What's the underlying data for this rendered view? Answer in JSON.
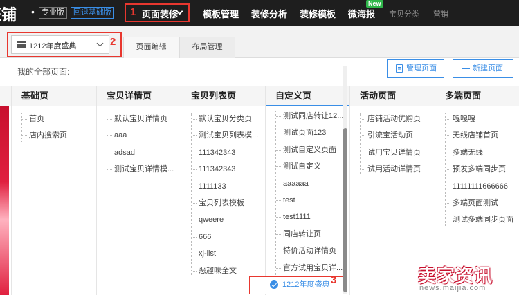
{
  "brand": {
    "logo_text": "旺铺",
    "pro_badge": "专业版",
    "back_badge": "回退基础版"
  },
  "nav": {
    "items": [
      "页面装修",
      "模板管理",
      "装修分析",
      "装修模板",
      "微海报",
      "宝贝分类",
      "营销"
    ],
    "new_badge": "New"
  },
  "annotations": {
    "n1": "1",
    "n2": "2",
    "n3": "3"
  },
  "toolbar": {
    "page_select_value": "1212年度盛典",
    "tabs": [
      "页面编辑",
      "布局管理"
    ]
  },
  "panel": {
    "label": "我的全部页面:",
    "manage_button": "管理页面",
    "new_button": "新建页面",
    "columns": [
      {
        "title": "基础页",
        "items": [
          "首页",
          "店内搜索页"
        ]
      },
      {
        "title": "宝贝详情页",
        "items": [
          "默认宝贝详情页",
          "aaa",
          "adsad",
          "测试宝贝详情模..."
        ]
      },
      {
        "title": "宝贝列表页",
        "items": [
          "默认宝贝分类页",
          "测试宝贝列表模...",
          "111342343",
          "111342343",
          "1111133",
          "宝贝列表模板",
          "qweere",
          "666",
          "xj-list",
          "恶趣味全文"
        ]
      },
      {
        "title": "自定义页",
        "items": [
          "测试同店转让12...",
          "测试页面123",
          "测试自定义页面",
          "测试自定义",
          "aaaaaa",
          "test",
          "test1111",
          "同店转让页",
          "特价活动详情页",
          "官方试用宝贝详..."
        ],
        "selected": "1212年度盛典"
      },
      {
        "title": "活动页面",
        "items": [
          "店铺活动优购页",
          "引流宝活动页",
          "试用宝贝详情页",
          "试用活动详情页"
        ]
      },
      {
        "title": "多端页面",
        "items": [
          "嘎嘎嘎",
          "无线店铺首页",
          "多端无线",
          "预发多端同步页",
          "11111111666666",
          "多端页面测试",
          "测试多端同步页面"
        ]
      }
    ]
  },
  "watermark": {
    "big": "卖家资讯",
    "small": "news.maijia.com"
  },
  "colors": {
    "accent": "#3a8ee6",
    "highlight": "#e8372f",
    "topbar": "#1e1e1e"
  }
}
